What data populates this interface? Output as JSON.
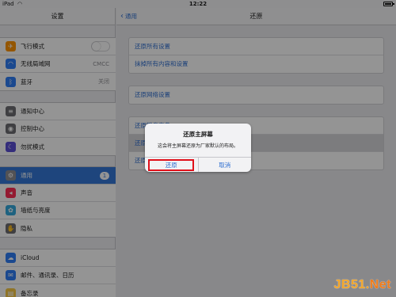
{
  "status_bar": {
    "carrier": "iPad",
    "time": "12:22"
  },
  "sidebar": {
    "title": "设置",
    "group1": [
      {
        "label": "飞行模式",
        "icon": "airplane-icon",
        "color": "#ff9500",
        "glyph": "✈",
        "control": "toggle"
      },
      {
        "label": "无线局域网",
        "icon": "wifi-icon",
        "color": "#2f7ef6",
        "glyph": "◠",
        "value": "CMCC"
      },
      {
        "label": "蓝牙",
        "icon": "bluetooth-icon",
        "color": "#2f7ef6",
        "glyph": "ᛒ",
        "value": "关闭"
      }
    ],
    "group2": [
      {
        "label": "通知中心",
        "icon": "notification-center-icon",
        "color": "#6d6d72",
        "glyph": "≡"
      },
      {
        "label": "控制中心",
        "icon": "control-center-icon",
        "color": "#6d6d72",
        "glyph": "◉"
      },
      {
        "label": "勿扰模式",
        "icon": "moon-icon",
        "color": "#5b4fd4",
        "glyph": "☾"
      }
    ],
    "group3": [
      {
        "label": "通用",
        "icon": "gear-icon",
        "color": "#8e8e93",
        "glyph": "⚙",
        "badge": "1",
        "selected": true
      },
      {
        "label": "声音",
        "icon": "speaker-icon",
        "color": "#ff2d55",
        "glyph": "◂"
      },
      {
        "label": "墙纸与亮度",
        "icon": "wallpaper-icon",
        "color": "#34aadc",
        "glyph": "✿"
      },
      {
        "label": "隐私",
        "icon": "hand-icon",
        "color": "#6d6d72",
        "glyph": "✋"
      }
    ],
    "group4": [
      {
        "label": "iCloud",
        "icon": "cloud-icon",
        "color": "#2f7ef6",
        "glyph": "☁"
      },
      {
        "label": "邮件、通讯录、日历",
        "icon": "mail-icon",
        "color": "#2f7ef6",
        "glyph": "✉"
      },
      {
        "label": "备忘录",
        "icon": "notes-icon",
        "color": "#f6c844",
        "glyph": "▤"
      }
    ]
  },
  "detail": {
    "back_label": "通用",
    "title": "还原",
    "group1": [
      "还原所有设置",
      "抹掉所有内容和设置"
    ],
    "group2": [
      "还原网络设置"
    ],
    "group3": [
      "还原键盘字典",
      "还原主屏幕布局",
      "还原位置与隐私"
    ]
  },
  "alert": {
    "title": "还原主屏幕",
    "message": "这会将主屏幕还原为厂家默认的布局。",
    "confirm": "还原",
    "cancel": "取消"
  },
  "watermark": {
    "main": "JB51.",
    "tail": "Net"
  }
}
